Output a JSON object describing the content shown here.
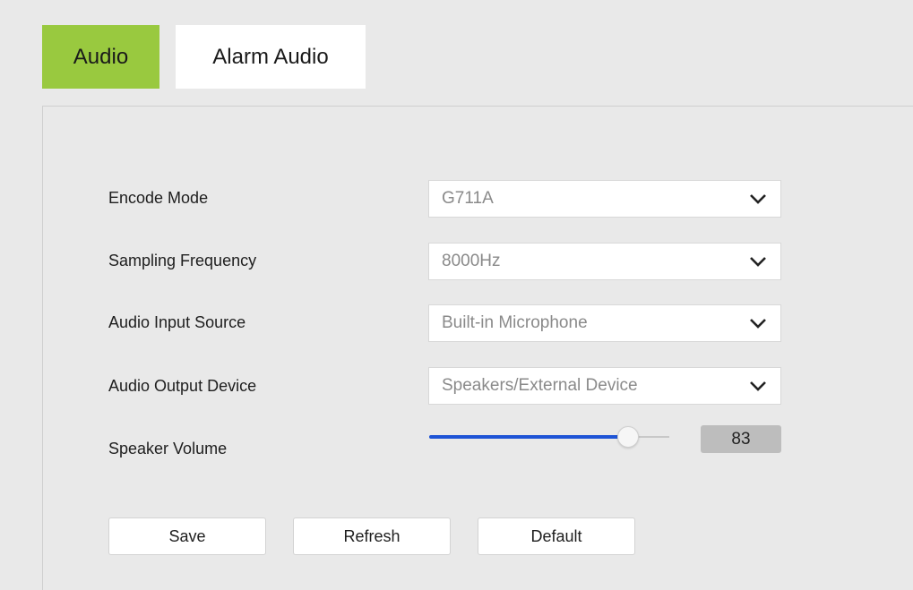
{
  "tabs": [
    {
      "label": "Audio",
      "active": true
    },
    {
      "label": "Alarm Audio",
      "active": false
    }
  ],
  "colors": {
    "active_tab": "#99c93f",
    "slider_fill": "#1e54d6",
    "page_background": "#e9e9e9"
  },
  "form": {
    "encode_mode": {
      "label": "Encode Mode",
      "value": "G711A"
    },
    "sampling_frequency": {
      "label": "Sampling Frequency",
      "value": "8000Hz"
    },
    "audio_input_source": {
      "label": "Audio Input Source",
      "value": "Built-in Microphone"
    },
    "audio_output_device": {
      "label": "Audio Output Device",
      "value": "Speakers/External Device"
    },
    "speaker_volume": {
      "label": "Speaker Volume",
      "value": "83",
      "level": 0.83
    }
  },
  "buttons": {
    "save": "Save",
    "refresh": "Refresh",
    "default": "Default"
  },
  "icons": {
    "dropdown": "chevron-down-icon"
  }
}
